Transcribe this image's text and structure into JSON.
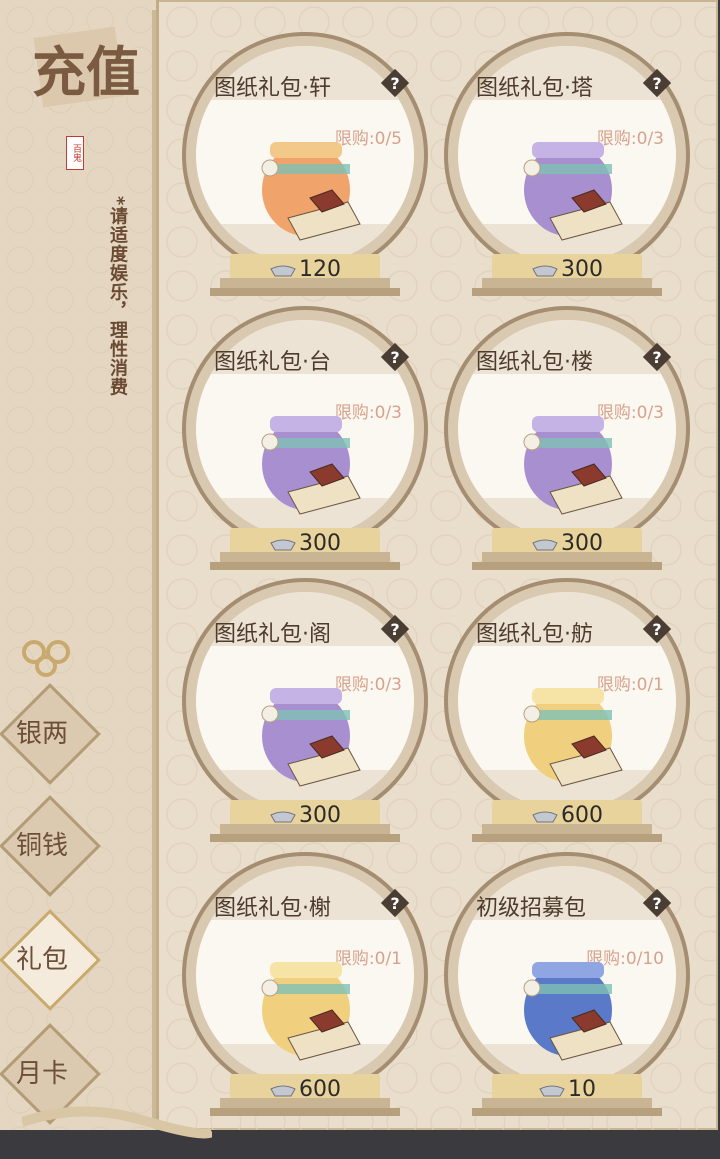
{
  "title": {
    "text": "充值",
    "seal_text": "百鬼"
  },
  "notice": "*请适度娱乐，理性消费",
  "tabs": [
    {
      "label": "银两",
      "active": false
    },
    {
      "label": "铜钱",
      "active": false
    },
    {
      "label": "礼包",
      "active": true
    },
    {
      "label": "月卡",
      "active": false
    }
  ],
  "colors": {
    "accent": "#c9a96e",
    "text": "#4d3b2d",
    "limit": "#d7a28c",
    "price_bar": "#e7d39b"
  },
  "packs": [
    {
      "name": "图纸礼包·轩",
      "limit": "限购:0/5",
      "price": "120",
      "bag": "orange"
    },
    {
      "name": "图纸礼包·塔",
      "limit": "限购:0/3",
      "price": "300",
      "bag": "purple"
    },
    {
      "name": "图纸礼包·台",
      "limit": "限购:0/3",
      "price": "300",
      "bag": "purple"
    },
    {
      "name": "图纸礼包·楼",
      "limit": "限购:0/3",
      "price": "300",
      "bag": "purple"
    },
    {
      "name": "图纸礼包·阁",
      "limit": "限购:0/3",
      "price": "300",
      "bag": "purple"
    },
    {
      "name": "图纸礼包·舫",
      "limit": "限购:0/1",
      "price": "600",
      "bag": "yellow"
    },
    {
      "name": "图纸礼包·榭",
      "limit": "限购:0/1",
      "price": "600",
      "bag": "yellow"
    },
    {
      "name": "初级招募包",
      "limit": "限购:0/10",
      "price": "10",
      "bag": "blue"
    }
  ]
}
